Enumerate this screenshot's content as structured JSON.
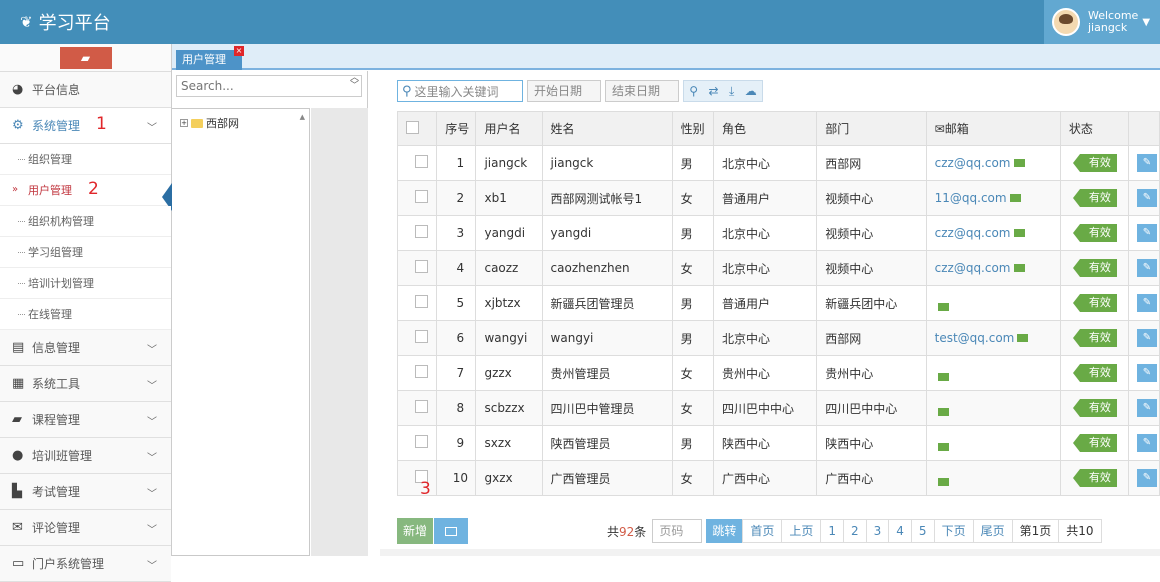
{
  "app": {
    "title": "学习平台",
    "welcome": "Welcome",
    "username": "jiangck"
  },
  "sidebar": {
    "items": [
      {
        "label": "平台信息",
        "icon": "dashboard-icon"
      },
      {
        "label": "系统管理",
        "icon": "gears-icon"
      },
      {
        "label": "信息管理",
        "icon": "list-icon"
      },
      {
        "label": "系统工具",
        "icon": "grid-icon"
      },
      {
        "label": "课程管理",
        "icon": "book-icon"
      },
      {
        "label": "培训班管理",
        "icon": "comments-icon"
      },
      {
        "label": "考试管理",
        "icon": "file-icon"
      },
      {
        "label": "评论管理",
        "icon": "envelope-icon"
      },
      {
        "label": "门户系统管理",
        "icon": "desktop-icon"
      }
    ],
    "sub_items": [
      "组织管理",
      "用户管理",
      "组织机构管理",
      "学习组管理",
      "培训计划管理",
      "在线管理"
    ]
  },
  "annotations": {
    "n1": "1",
    "n2": "2",
    "n3": "3"
  },
  "tab": {
    "label": "用户管理",
    "close": "×"
  },
  "tree": {
    "search_placeholder": "Search...",
    "root": "西部网"
  },
  "toolbar": {
    "keyword_placeholder": "这里输入关键词",
    "start_date": "开始日期",
    "end_date": "结束日期"
  },
  "table": {
    "headers": [
      "序号",
      "用户名",
      "姓名",
      "性别",
      "角色",
      "部门",
      "邮箱",
      "状态"
    ],
    "rows": [
      {
        "no": "1",
        "username": "jiangck",
        "name": "jiangck",
        "gender": "男",
        "role": "北京中心",
        "dept": "西部网",
        "email": "czz@qq.com",
        "status": "有效"
      },
      {
        "no": "2",
        "username": "xb1",
        "name": "西部网测试帐号1",
        "gender": "女",
        "role": "普通用户",
        "dept": "视频中心",
        "email": "11@qq.com",
        "status": "有效"
      },
      {
        "no": "3",
        "username": "yangdi",
        "name": "yangdi",
        "gender": "男",
        "role": "北京中心",
        "dept": "视频中心",
        "email": "czz@qq.com",
        "status": "有效"
      },
      {
        "no": "4",
        "username": "caozz",
        "name": "caozhenzhen",
        "gender": "女",
        "role": "北京中心",
        "dept": "视频中心",
        "email": "czz@qq.com",
        "status": "有效"
      },
      {
        "no": "5",
        "username": "xjbtzx",
        "name": "新疆兵团管理员",
        "gender": "男",
        "role": "普通用户",
        "dept": "新疆兵团中心",
        "email": "",
        "status": "有效"
      },
      {
        "no": "6",
        "username": "wangyi",
        "name": "wangyi",
        "gender": "男",
        "role": "北京中心",
        "dept": "西部网",
        "email": "test@qq.com",
        "status": "有效"
      },
      {
        "no": "7",
        "username": "gzzx",
        "name": "贵州管理员",
        "gender": "女",
        "role": "贵州中心",
        "dept": "贵州中心",
        "email": "",
        "status": "有效"
      },
      {
        "no": "8",
        "username": "scbzzx",
        "name": "四川巴中管理员",
        "gender": "女",
        "role": "四川巴中中心",
        "dept": "四川巴中中心",
        "email": "",
        "status": "有效"
      },
      {
        "no": "9",
        "username": "sxzx",
        "name": "陕西管理员",
        "gender": "男",
        "role": "陕西中心",
        "dept": "陕西中心",
        "email": "",
        "status": "有效"
      },
      {
        "no": "10",
        "username": "gxzx",
        "name": "广西管理员",
        "gender": "女",
        "role": "广西中心",
        "dept": "广西中心",
        "email": "",
        "status": "有效"
      }
    ]
  },
  "footer": {
    "add_label": "新增",
    "total_prefix": "共",
    "total_count": "92",
    "total_suffix": "条",
    "page_input_placeholder": "页码",
    "go_label": "跳转",
    "links": [
      "首页",
      "上页",
      "1",
      "2",
      "3",
      "4",
      "5",
      "下页",
      "尾页",
      "第1页",
      "共10"
    ]
  }
}
